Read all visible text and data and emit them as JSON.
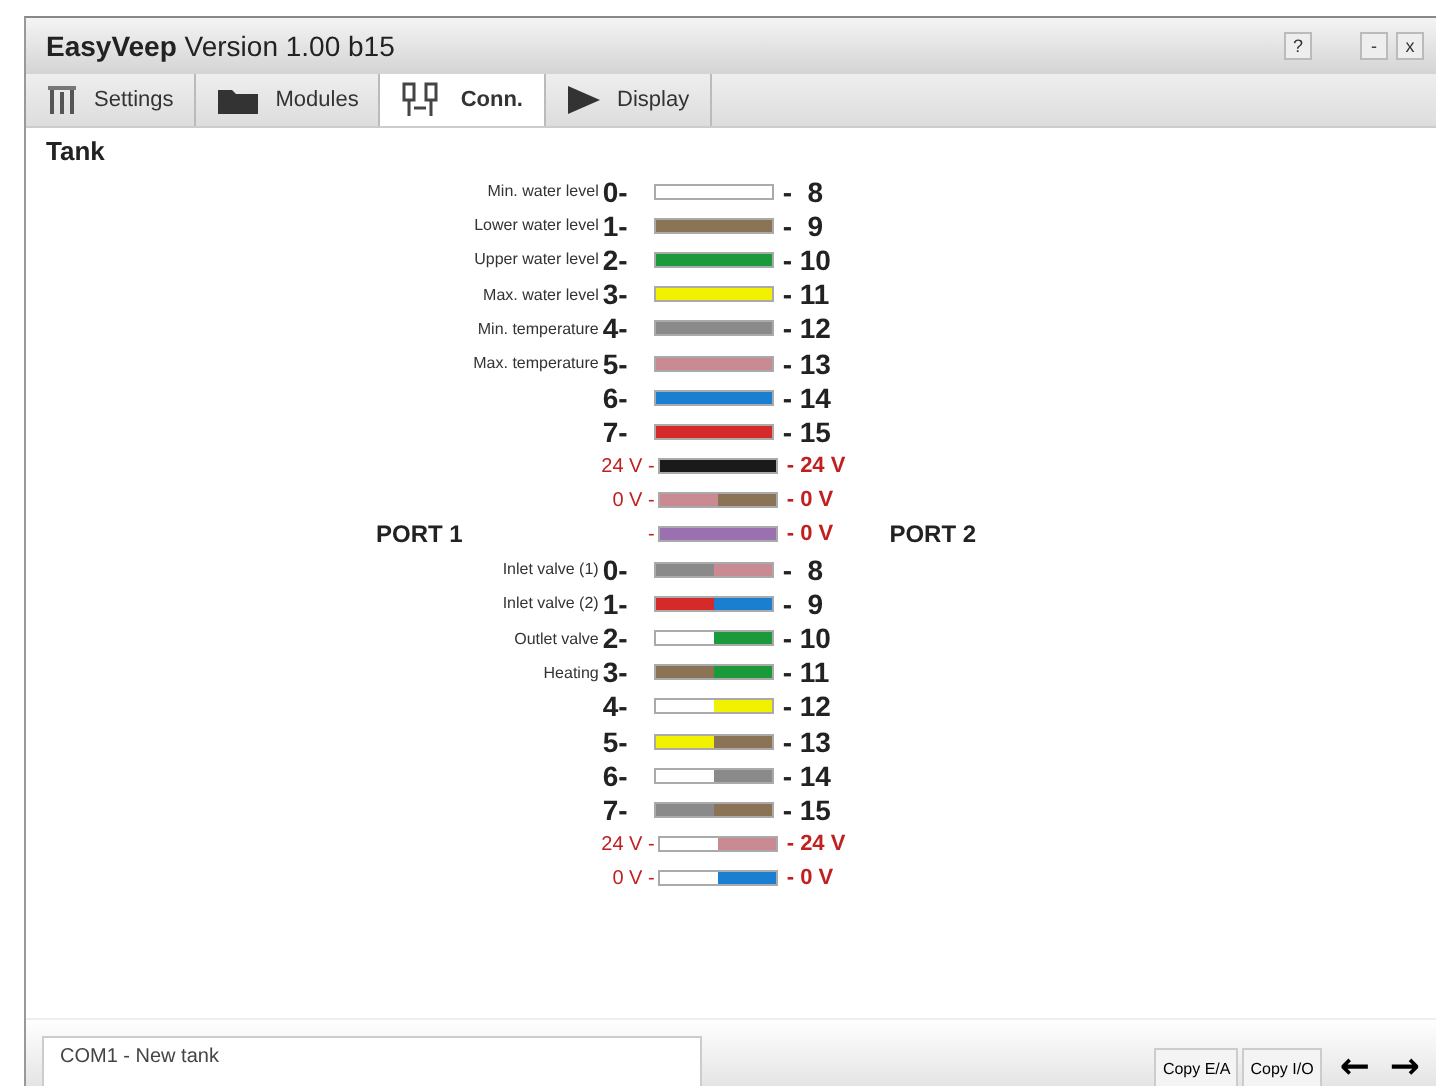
{
  "window": {
    "title_bold": "EasyVeep",
    "title": "Version 1.00 b15",
    "buttons": [
      "?",
      "-",
      "x"
    ]
  },
  "tabs": [
    {
      "label": "Settings",
      "selected": false
    },
    {
      "label": "Modules",
      "selected": false
    },
    {
      "label": "Conn.",
      "selected": true
    },
    {
      "label": "Display",
      "selected": false
    }
  ],
  "heading": "Tank",
  "ports": [
    "PORT 1",
    "PORT 2"
  ],
  "wires": [
    {
      "kind": "signal",
      "description": "Min. water level",
      "pin": "0-",
      "target": "-  8",
      "ends": [
        {
          "color": "#ffffff"
        },
        {
          "color": "#ffffff"
        }
      ]
    },
    {
      "kind": "signal",
      "description": "Lower water level",
      "pin": "1-",
      "target": "-  9",
      "ends": [
        {
          "color": "#8b7355"
        },
        {
          "color": "#8b7355"
        }
      ]
    },
    {
      "kind": "signal",
      "description": "Upper water level",
      "pin": "2-",
      "target": "- 10",
      "ends": [
        {
          "color": "#1a9a3a"
        },
        {
          "color": "#1a9a3a"
        }
      ]
    },
    {
      "kind": "signal",
      "description": "Max. water level",
      "pin": "3-",
      "target": "- 11",
      "ends": [
        {
          "color": "#f2f200"
        },
        {
          "color": "#f2f200"
        }
      ]
    },
    {
      "kind": "signal",
      "description": "Min. temperature",
      "pin": "4-",
      "target": "- 12",
      "ends": [
        {
          "color": "#8a8a8a"
        },
        {
          "color": "#8a8a8a"
        }
      ]
    },
    {
      "kind": "signal",
      "description": "Max. temperature",
      "pin": "5-",
      "target": "- 13",
      "ends": [
        {
          "color": "#c98a92"
        },
        {
          "color": "#c98a92"
        }
      ]
    },
    {
      "kind": "signal",
      "pin": "6-",
      "target": "- 14",
      "ends": [
        {
          "color": "#1a7fd0"
        },
        {
          "color": "#1a7fd0"
        }
      ]
    },
    {
      "kind": "signal",
      "pin": "7-",
      "target": "- 15",
      "ends": [
        {
          "color": "#d42a2a"
        },
        {
          "color": "#d42a2a"
        }
      ]
    },
    {
      "kind": "power",
      "pin": "24 V -",
      "target": "- 24 V",
      "ends": [
        {
          "color": "#1a1a1a"
        },
        {
          "color": "#1a1a1a"
        }
      ]
    },
    {
      "kind": "power",
      "pin": "0 V -",
      "target": "- 0 V",
      "ends": [
        {
          "color": "#c98a92"
        },
        {
          "color": "#8b7355"
        }
      ]
    },
    {
      "kind": "power",
      "pin": "-",
      "target": "- 0 V",
      "ends": [
        {
          "color": "#9a70b0"
        },
        {
          "color": "#9a70b0"
        }
      ]
    },
    {
      "kind": "signal",
      "description": "Inlet valve (1)",
      "pin": "0-",
      "target": "-  8",
      "ends": [
        {
          "color": "#8a8a8a"
        },
        {
          "color": "#c98a92"
        }
      ]
    },
    {
      "kind": "signal",
      "description": "Inlet valve (2)",
      "pin": "1-",
      "target": "-  9",
      "ends": [
        {
          "color": "#d42a2a"
        },
        {
          "color": "#1a7fd0"
        }
      ]
    },
    {
      "kind": "signal",
      "description": "Outlet valve",
      "pin": "2-",
      "target": "- 10",
      "ends": [
        {
          "color": "#ffffff"
        },
        {
          "color": "#1a9a3a"
        }
      ]
    },
    {
      "kind": "signal",
      "description": "Heating",
      "pin": "3-",
      "target": "- 11",
      "ends": [
        {
          "color": "#8b7355"
        },
        {
          "color": "#1a9a3a"
        }
      ]
    },
    {
      "kind": "signal",
      "pin": "4-",
      "target": "- 12",
      "ends": [
        {
          "color": "#ffffff"
        },
        {
          "color": "#f2f200"
        }
      ]
    },
    {
      "kind": "signal",
      "pin": "5-",
      "target": "- 13",
      "ends": [
        {
          "color": "#f2f200"
        },
        {
          "color": "#8b7355"
        }
      ]
    },
    {
      "kind": "signal",
      "pin": "6-",
      "target": "- 14",
      "ends": [
        {
          "color": "#ffffff"
        },
        {
          "color": "#8a8a8a"
        }
      ]
    },
    {
      "kind": "signal",
      "pin": "7-",
      "target": "- 15",
      "ends": [
        {
          "color": "#8a8a8a"
        },
        {
          "color": "#8b7355"
        }
      ]
    },
    {
      "kind": "power",
      "pin": "24 V -",
      "target": "- 24 V",
      "ends": [
        {
          "color": "#ffffff"
        },
        {
          "color": "#c98a92"
        }
      ]
    },
    {
      "kind": "power",
      "pin": "0 V -",
      "target": "- 0 V",
      "ends": [
        {
          "color": "#ffffff"
        },
        {
          "color": "#1a7fd0"
        }
      ]
    }
  ],
  "status": "COM1 - New tank",
  "actions": [
    "Copy E/A",
    "Copy I/O"
  ],
  "nav": [
    "←",
    "→"
  ]
}
